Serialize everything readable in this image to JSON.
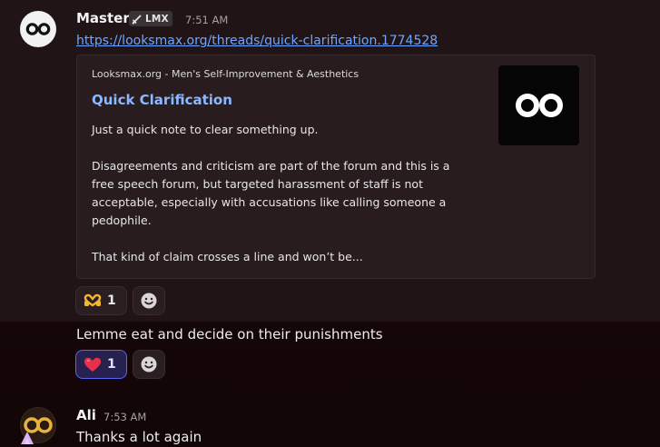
{
  "messages": [
    {
      "author": "Master",
      "tag": {
        "label": "LMX",
        "icon": "sword-icon"
      },
      "time": "7:51 AM",
      "link": "https://looksmax.org/threads/quick-clarification.1774528",
      "embed": {
        "provider": "Looksmax.org - Men's Self-Improvement & Aesthetics",
        "title": "Quick Clarification",
        "description": [
          "Just a quick note to clear something up.",
          "Disagreements and criticism are part of the forum and this is a free speech forum, but targeted harassment of staff is not acceptable, especially with accusations like calling someone a pedophile.",
          "That kind of claim crosses a line and won’t be..."
        ],
        "thumbnail_icon": "infinity-logo-icon"
      },
      "reactions": [
        {
          "emoji": "heart-hands-emoji",
          "count": "1"
        }
      ]
    },
    {
      "text": "Lemme eat and decide on their punishments",
      "reactions": [
        {
          "emoji": "red-heart-emoji",
          "count": "1",
          "active": true
        }
      ]
    },
    {
      "author": "Ali",
      "time": "7:53 AM",
      "text": "Thanks a lot again"
    }
  ],
  "colors": {
    "link": "#6ea7ff",
    "embed_title": "#8cb8ff",
    "active_reaction_border": "#5865f2"
  }
}
